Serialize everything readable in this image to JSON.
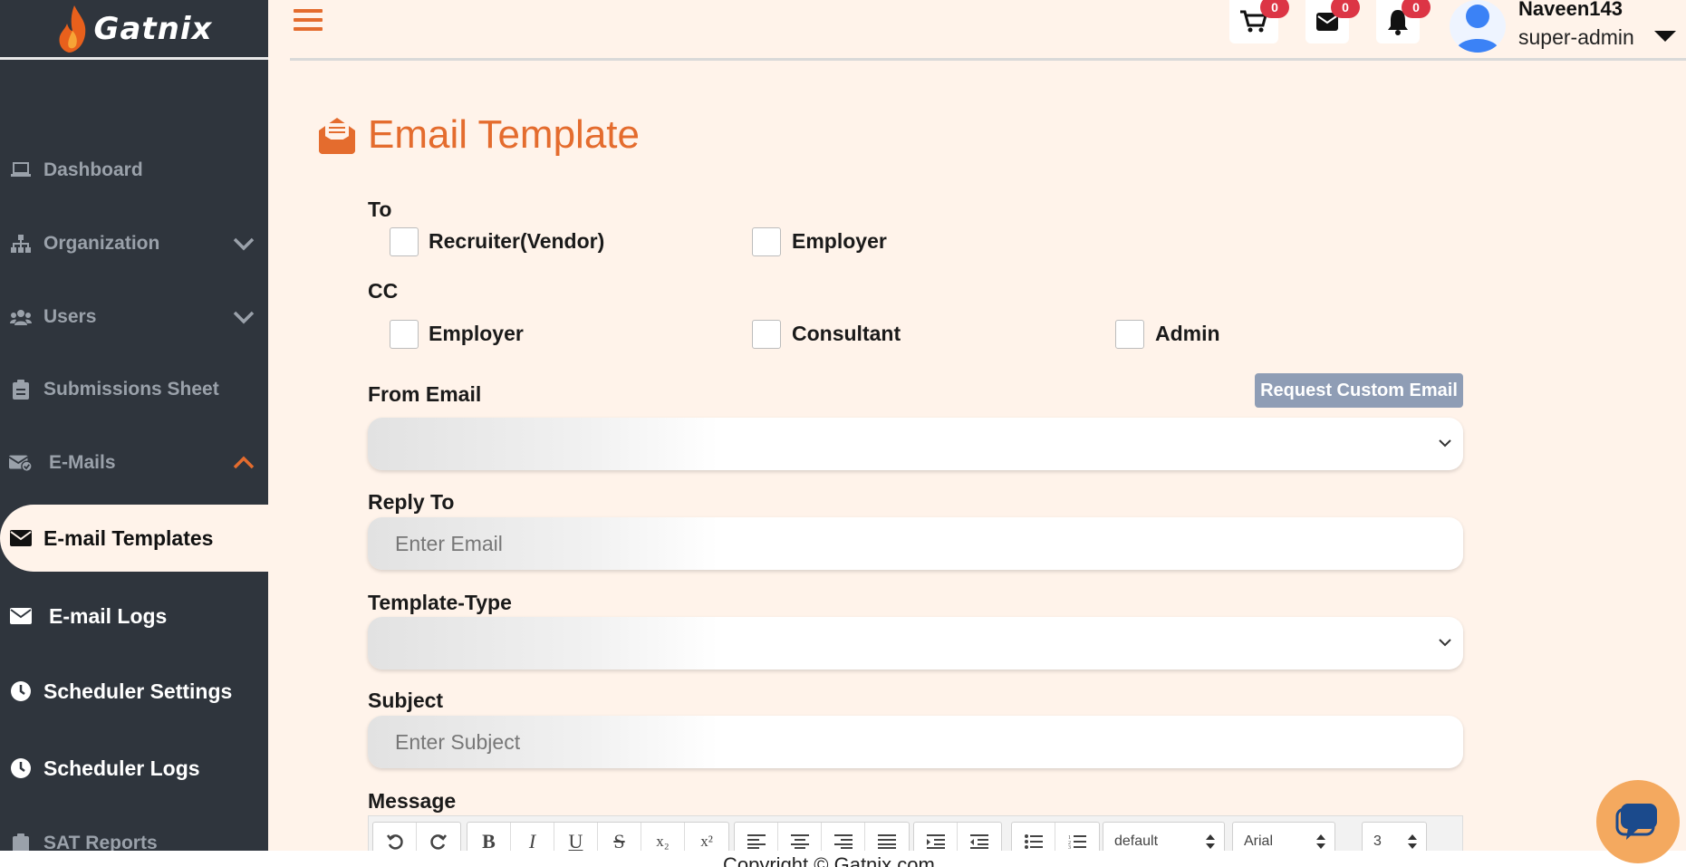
{
  "brand": {
    "name": "Gatnix",
    "accent": "#e46c2e",
    "sidebar_bg": "#2f353d"
  },
  "sidebar": {
    "items": [
      {
        "label": "Dashboard",
        "icon": "laptop-icon"
      },
      {
        "label": "Organization",
        "icon": "sitemap-icon",
        "chevron": "down"
      },
      {
        "label": "Users",
        "icon": "users-icon",
        "chevron": "down"
      },
      {
        "label": "Submissions Sheet",
        "icon": "clipboard-icon"
      },
      {
        "label": "E-Mails",
        "icon": "envelope-check-icon",
        "chevron": "up"
      },
      {
        "label": "E-mail Templates",
        "icon": "envelope-icon",
        "active": true
      },
      {
        "label": "E-mail Logs",
        "icon": "envelope-icon"
      },
      {
        "label": "Scheduler Settings",
        "icon": "clock-icon"
      },
      {
        "label": "Scheduler Logs",
        "icon": "clock-icon"
      },
      {
        "label": "SAT Reports",
        "icon": "clipboard-icon"
      }
    ]
  },
  "header": {
    "cart_count": "0",
    "mail_count": "0",
    "bell_count": "0",
    "user_name": "Naveen143",
    "user_role": "super-admin"
  },
  "main": {
    "title": "Email Template",
    "to_label": "To",
    "to_options": [
      "Recruiter(Vendor)",
      "Employer"
    ],
    "cc_label": "CC",
    "cc_options": [
      "Employer",
      "Consultant",
      "Admin"
    ],
    "from_email_label": "From Email",
    "request_custom_email": "Request Custom Email",
    "reply_to_label": "Reply To",
    "reply_to_placeholder": "Enter Email",
    "template_type_label": "Template-Type",
    "subject_label": "Subject",
    "subject_placeholder": "Enter Subject",
    "message_label": "Message"
  },
  "editor": {
    "font_size_select": "default",
    "font_family_select": "Arial",
    "size_select": "3"
  },
  "footer": {
    "copyright": "Copyright © Gatnix.com"
  }
}
